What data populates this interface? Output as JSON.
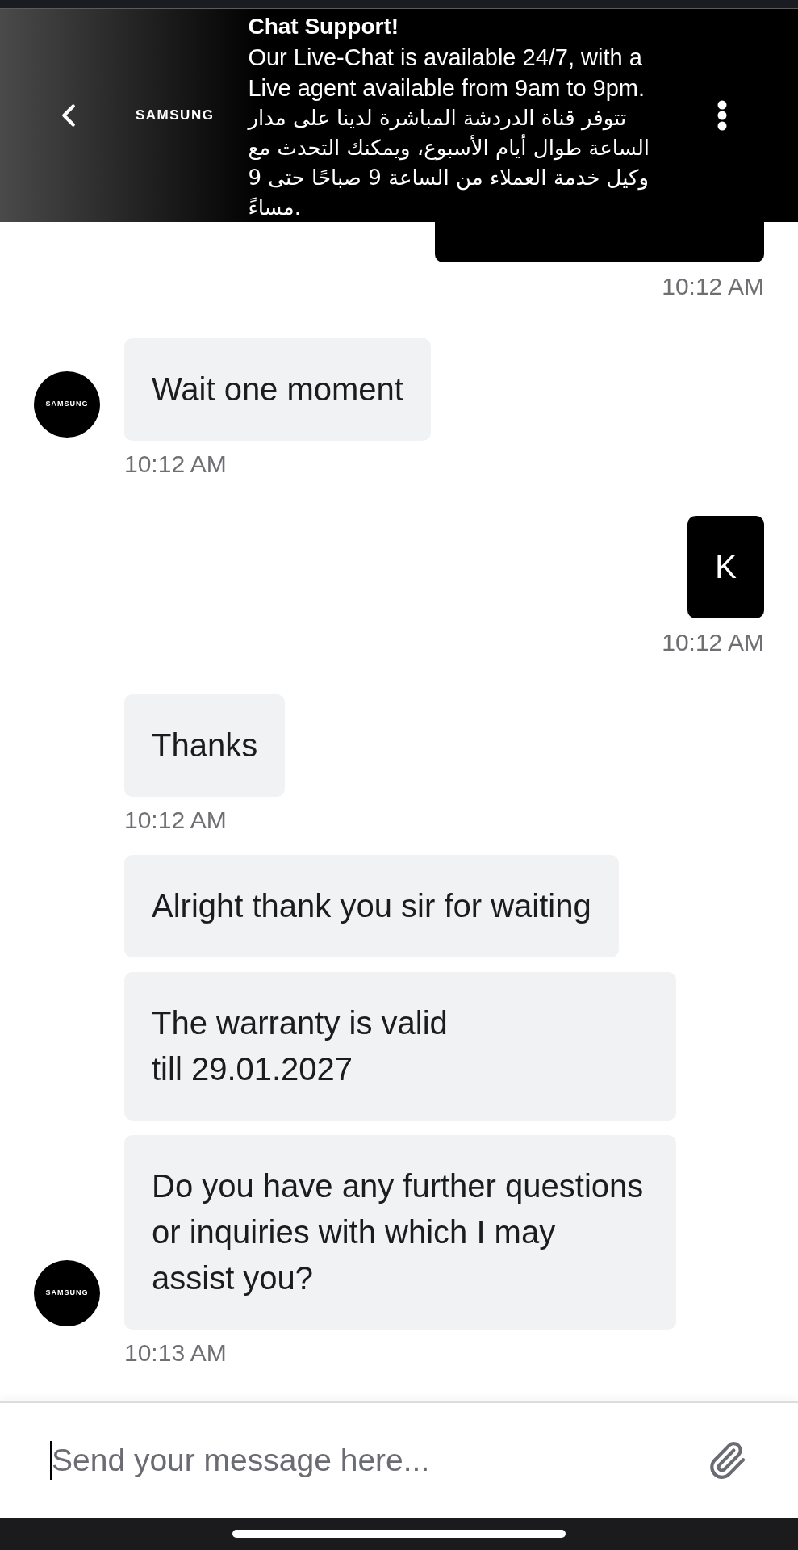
{
  "header": {
    "logo": "SAMSUNG",
    "title": "Chat Support!",
    "notice": "Our Live-Chat is available 24/7, with a\nLive agent available from 9am to 9pm.",
    "notice_arabic": "تتوفر قناة الدردشة المباشرة لدينا على مدار\nالساعة طوال أيام الأسبوع، ويمكنك التحدث مع\nوكيل خدمة العملاء من الساعة 9 صباحًا حتى 9\nمساءً."
  },
  "messages": [
    {
      "kind": "user",
      "time": "10:12 AM"
    },
    {
      "kind": "agent",
      "avatar": "SAMSUNG",
      "text": "Wait one moment",
      "time": "10:12 AM"
    },
    {
      "kind": "user",
      "text": "K",
      "time": "10:12 AM"
    },
    {
      "kind": "agent",
      "text": "Thanks",
      "time": "10:12 AM"
    },
    {
      "kind": "agent",
      "text": "Alright thank you sir for waiting"
    },
    {
      "kind": "agent",
      "text": "The warranty is valid\ntill 29.01.2027"
    },
    {
      "kind": "agent",
      "avatar": "SAMSUNG",
      "text": "Do you have any further questions\nor inquiries with which I may\nassist you?",
      "time": "10:13 AM"
    }
  ],
  "composer": {
    "placeholder": "Send your message here..."
  }
}
